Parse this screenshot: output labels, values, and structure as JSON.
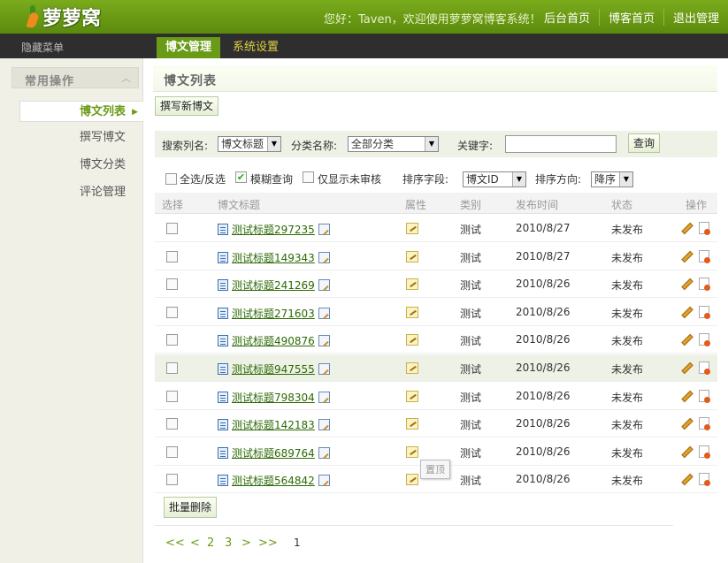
{
  "header": {
    "logo_text": "萝萝窝",
    "welcome": "您好：Taven，欢迎使用萝萝窝博客系统！",
    "links": [
      "后台首页",
      "博客首页",
      "退出管理"
    ]
  },
  "subnav": {
    "hide_menu": "隐藏菜单",
    "main_tab": "博文管理",
    "sub_tab": "系统设置"
  },
  "sidebar": {
    "heading": "常用操作",
    "collapse_glyph": "︿",
    "items": [
      {
        "label": "博文列表",
        "active": true
      },
      {
        "label": "撰写博文",
        "active": false
      },
      {
        "label": "博文分类",
        "active": false
      },
      {
        "label": "评论管理",
        "active": false
      }
    ]
  },
  "main": {
    "section_title": "博文列表",
    "new_post_button": "撰写新博文",
    "search": {
      "column_label": "搜索列名:",
      "column_value": "博文标题",
      "category_label": "分类名称:",
      "category_value": "全部分类",
      "keyword_label": "关键字:",
      "keyword_value": "",
      "query_button": "查询"
    },
    "filters": {
      "select_all": "全选/反选",
      "fuzzy": "模糊查询",
      "fuzzy_checked": true,
      "unreviewed": "仅显示未审核",
      "sort_field_label": "排序字段:",
      "sort_field_value": "博文ID",
      "sort_dir_label": "排序方向:",
      "sort_dir_value": "降序"
    },
    "table": {
      "columns": [
        "选择",
        "博文标题",
        "属性",
        "类别",
        "发布时间",
        "状态",
        "操作"
      ],
      "rows": [
        {
          "title": "测试标题297235",
          "category": "测试",
          "date": "2010/8/27",
          "status": "未发布"
        },
        {
          "title": "测试标题149343",
          "category": "测试",
          "date": "2010/8/27",
          "status": "未发布"
        },
        {
          "title": "测试标题241269",
          "category": "测试",
          "date": "2010/8/26",
          "status": "未发布"
        },
        {
          "title": "测试标题271603",
          "category": "测试",
          "date": "2010/8/26",
          "status": "未发布"
        },
        {
          "title": "测试标题490876",
          "category": "测试",
          "date": "2010/8/26",
          "status": "未发布"
        },
        {
          "title": "测试标题947555",
          "category": "测试",
          "date": "2010/8/26",
          "status": "未发布"
        },
        {
          "title": "测试标题798304",
          "category": "测试",
          "date": "2010/8/26",
          "status": "未发布"
        },
        {
          "title": "测试标题142183",
          "category": "测试",
          "date": "2010/8/26",
          "status": "未发布"
        },
        {
          "title": "测试标题689764",
          "category": "测试",
          "date": "2010/8/26",
          "status": "未发布"
        },
        {
          "title": "测试标题564842",
          "category": "测试",
          "date": "2010/8/26",
          "status": "未发布"
        }
      ]
    },
    "tooltip": "置顶",
    "batch_delete_button": "批量删除",
    "pager": {
      "first": "<<",
      "prev": "<",
      "pages": [
        "2",
        "3"
      ],
      "next": ">",
      "last": ">>",
      "current": "1"
    }
  },
  "colors": {
    "brand_green": "#6a9b16",
    "link_green": "#2c6a05",
    "dark_bar": "#2e2e2e"
  }
}
